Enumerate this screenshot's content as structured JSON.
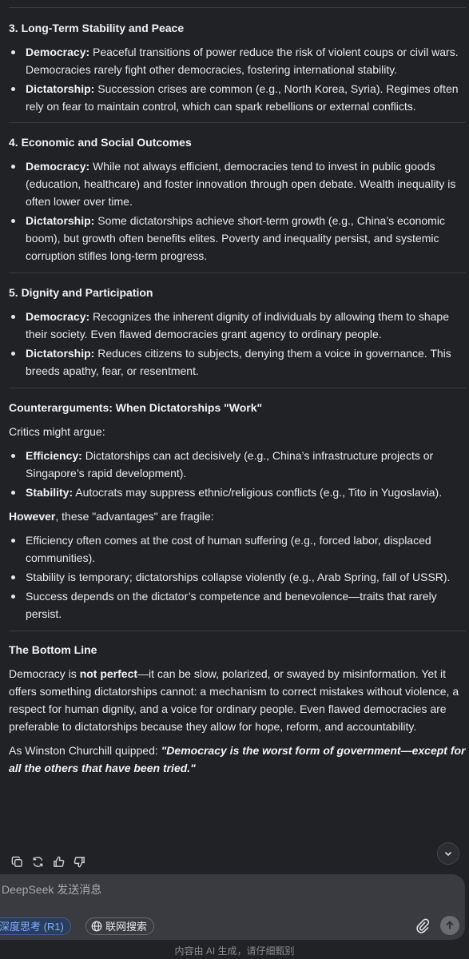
{
  "sections": [
    {
      "title": "3. Long-Term Stability and Peace",
      "bullets": [
        {
          "label": "Democracy:",
          "text": "Peaceful transitions of power reduce the risk of violent coups or civil wars. Democracies rarely fight other democracies, fostering international stability."
        },
        {
          "label": "Dictatorship:",
          "text": "Succession crises are common (e.g., North Korea, Syria). Regimes often rely on fear to maintain control, which can spark rebellions or external conflicts."
        }
      ]
    },
    {
      "title": "4. Economic and Social Outcomes",
      "bullets": [
        {
          "label": "Democracy:",
          "text": "While not always efficient, democracies tend to invest in public goods (education, healthcare) and foster innovation through open debate. Wealth inequality is often lower over time."
        },
        {
          "label": "Dictatorship:",
          "text": "Some dictatorships achieve short-term growth (e.g., China’s economic boom), but growth often benefits elites. Poverty and inequality persist, and systemic corruption stifles long-term progress."
        }
      ]
    },
    {
      "title": "5. Dignity and Participation",
      "bullets": [
        {
          "label": "Democracy:",
          "text": "Recognizes the inherent dignity of individuals by allowing them to shape their society. Even flawed democracies grant agency to ordinary people."
        },
        {
          "label": "Dictatorship:",
          "text": "Reduces citizens to subjects, denying them a voice in governance. This breeds apathy, fear, or resentment."
        }
      ]
    }
  ],
  "counter": {
    "title": "Counterarguments: When Dictatorships \"Work\"",
    "intro": "Critics might argue:",
    "bullets": [
      {
        "label": "Efficiency:",
        "text": "Dictatorships can act decisively (e.g., China’s infrastructure projects or Singapore’s rapid development)."
      },
      {
        "label": "Stability:",
        "text": "Autocrats may suppress ethnic/religious conflicts (e.g., Tito in Yugoslavia)."
      }
    ],
    "however_bold": "However",
    "however_rest": ", these \"advantages\" are fragile:",
    "fragile": [
      "Efficiency often comes at the cost of human suffering (e.g., forced labor, displaced communities).",
      "Stability is temporary; dictatorships collapse violently (e.g., Arab Spring, fall of USSR).",
      "Success depends on the dictator’s competence and benevolence—traits that rarely persist."
    ]
  },
  "bottom": {
    "title": "The Bottom Line",
    "p1_a": "Democracy is ",
    "p1_bold": "not perfect",
    "p1_b": "—it can be slow, polarized, or swayed by misinformation. Yet it offers something dictatorships cannot: a mechanism to correct mistakes without violence, a respect for human dignity, and a voice for ordinary people. Even flawed democracies are preferable to dictatorships because they allow for hope, reform, and accountability.",
    "quote_lead": "As Winston Churchill quipped: ",
    "quote": "\"Democracy is the worst form of government—except for all the others that have been tried.\""
  },
  "composer": {
    "placeholder": "DeepSeek 发送消息",
    "deep_think": "深度思考 (R1)",
    "web_search": "联网搜索"
  },
  "footer": "内容由 AI 生成，请仔细甄别",
  "colors": {
    "background": "#212226",
    "text": "#e8e8ea",
    "accent": "#7fb0ff",
    "composer_bg": "#3a3b40"
  },
  "icons": [
    "copy-icon",
    "regenerate-icon",
    "thumbs-up-icon",
    "thumbs-down-icon",
    "scroll-down-icon",
    "globe-icon",
    "paperclip-icon",
    "send-arrow-icon"
  ]
}
